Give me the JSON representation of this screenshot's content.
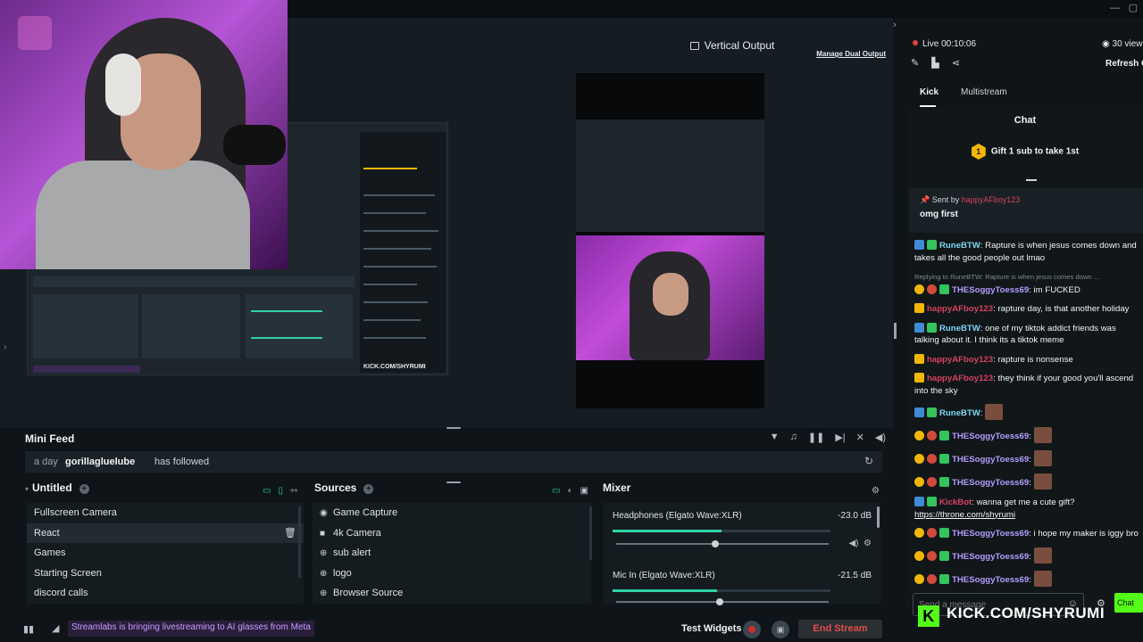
{
  "window": {
    "minimize": "—",
    "maximize": "▢"
  },
  "preview": {
    "vertical_label": "Vertical Output",
    "manage_dual": "Manage Dual Output",
    "embedded_kick": "KICK.COM/SHYRUMI"
  },
  "mini_feed": {
    "title": "Mini Feed",
    "time": "a day",
    "user": "gorillagluelube",
    "action": "has followed"
  },
  "scenes": {
    "title": "Untitled",
    "items": [
      "Fullscreen Camera",
      "React",
      "Games",
      "Starting Screen",
      "discord calls"
    ],
    "selected": "React"
  },
  "sources": {
    "title": "Sources",
    "items": [
      {
        "label": "Game Capture",
        "icon": "gamepad-icon"
      },
      {
        "label": "4k Camera",
        "icon": "camera-icon"
      },
      {
        "label": "sub alert",
        "icon": "globe-icon"
      },
      {
        "label": "logo",
        "icon": "globe-icon"
      },
      {
        "label": "Browser Source",
        "icon": "globe-icon"
      }
    ]
  },
  "mixer": {
    "title": "Mixer",
    "channels": [
      {
        "name": "Headphones (Elgato Wave:XLR)",
        "db": "-23.0 dB",
        "level": 0.5,
        "volume": 0.45
      },
      {
        "name": "Mic In (Elgato Wave:XLR)",
        "db": "-21.5 dB",
        "level": 0.48,
        "volume": 0.47
      }
    ]
  },
  "footer": {
    "notice": "Streamlabs is bringing livestreaming to AI glasses from Meta",
    "test_widgets": "Test Widgets",
    "end_stream": "End Stream"
  },
  "right": {
    "live": "Live 00:10:06",
    "viewers": "30 view",
    "refresh_chat": "Refresh C",
    "tabs": [
      "Kick",
      "Multistream"
    ],
    "chat_title": "Chat",
    "gift_badge": "1",
    "gift_text": "Gift 1 sub to take 1st",
    "pinned": {
      "sent_by_label": "Sent by",
      "sent_by_user": "happyAFboy123",
      "message": "omg first"
    },
    "input_placeholder": "Send a message",
    "chat_button": "Chat",
    "watermark": "KICK.COM/SHYRUMI"
  },
  "chat_messages": [
    {
      "user": "RuneBTW",
      "color": "#7ed6f5",
      "text": "Rapture is when jesus comes down and takes all the good people out lmao",
      "badges": [
        "x",
        "g"
      ]
    },
    {
      "reply": "Replying to RuneBTW: Rapture is when jesus comes down ...",
      "user": "THESoggyToess69",
      "color": "#b39cff",
      "text": "im FUCKED",
      "badges": [
        "c",
        "r",
        "g"
      ]
    },
    {
      "user": "happyAFboy123",
      "color": "#d64262",
      "text": "rapture day, is that another holiday",
      "badges": [
        "k"
      ]
    },
    {
      "user": "RuneBTW",
      "color": "#7ed6f5",
      "text": "one of my tiktok addict friends was talking about it. I think its a tiktok meme",
      "badges": [
        "x",
        "g"
      ]
    },
    {
      "user": "happyAFboy123",
      "color": "#d64262",
      "text": "rapture is nonsense",
      "badges": [
        "k"
      ]
    },
    {
      "user": "happyAFboy123",
      "color": "#d64262",
      "text": "they think if your good you'll ascend into the sky",
      "badges": [
        "k"
      ]
    },
    {
      "user": "RuneBTW",
      "color": "#7ed6f5",
      "text": "",
      "badges": [
        "x",
        "g"
      ],
      "emote": true
    },
    {
      "user": "THESoggyToess69",
      "color": "#b39cff",
      "text": "",
      "badges": [
        "c",
        "r",
        "g"
      ],
      "emote": true
    },
    {
      "user": "THESoggyToess69",
      "color": "#b39cff",
      "text": "",
      "badges": [
        "c",
        "r",
        "g"
      ],
      "emote": true
    },
    {
      "user": "THESoggyToess69",
      "color": "#b39cff",
      "text": "",
      "badges": [
        "c",
        "r",
        "g"
      ],
      "emote": true
    },
    {
      "user": "KickBot",
      "color": "#d64262",
      "text": "wanna get me a cute gift?",
      "link": "https://throne.com/shyrumi",
      "badges": [
        "x",
        "g"
      ]
    },
    {
      "user": "THESoggyToess69",
      "color": "#b39cff",
      "text": "i hope my maker is iggy bro",
      "badges": [
        "c",
        "r",
        "g"
      ]
    },
    {
      "user": "THESoggyToess69",
      "color": "#b39cff",
      "text": "",
      "badges": [
        "c",
        "r",
        "g"
      ],
      "emote": true
    },
    {
      "user": "THESoggyToess69",
      "color": "#b39cff",
      "text": "",
      "badges": [
        "c",
        "r",
        "g"
      ],
      "emote": true
    }
  ]
}
